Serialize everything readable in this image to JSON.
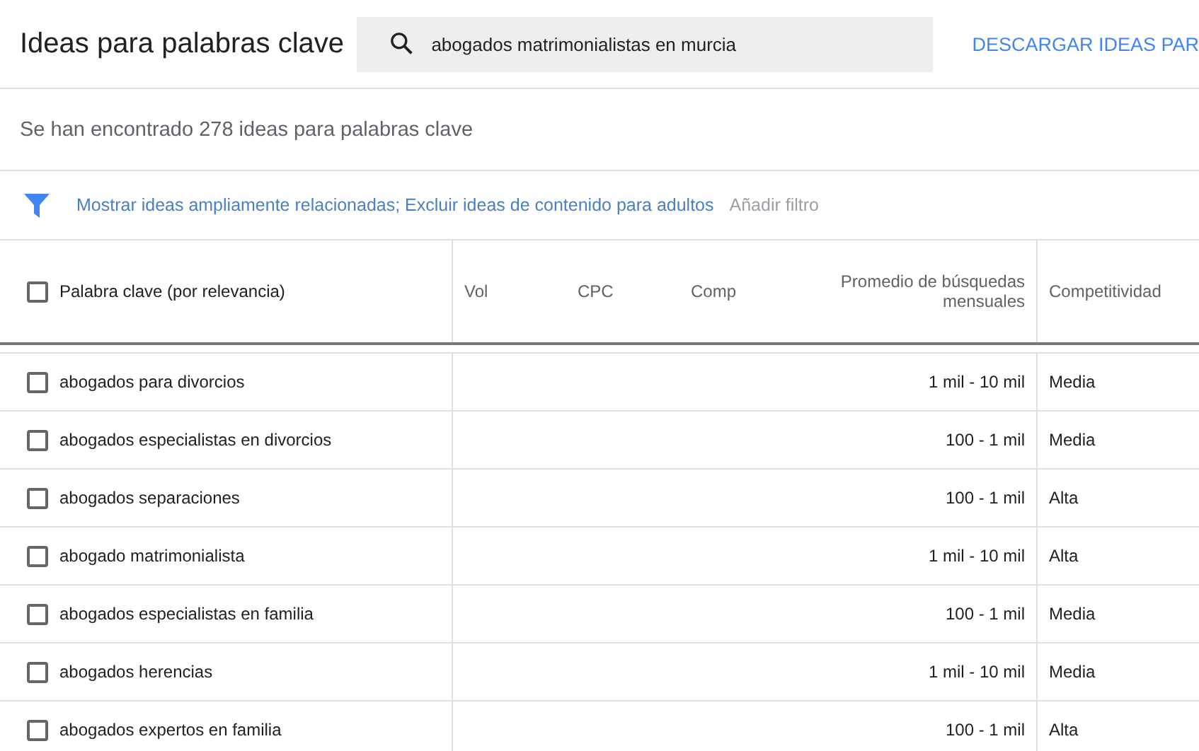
{
  "header": {
    "title": "Ideas para palabras clave",
    "search": {
      "value": "abogados matrimonialistas en murcia"
    },
    "download_button": "DESCARGAR IDEAS PAR"
  },
  "summary": "Se han encontrado 278 ideas para palabras clave",
  "filter": {
    "text": "Mostrar ideas ampliamente relacionadas; Excluir ideas de contenido para adultos",
    "add_filter": "Añadir filtro"
  },
  "table": {
    "select_all": {
      "checked": false
    },
    "columns": [
      "Palabra clave (por relevancia)",
      "Vol",
      "CPC",
      "Comp",
      "Promedio de búsquedas mensuales",
      "Competitividad"
    ],
    "rows": [
      {
        "keyword": "abogados para divorcios",
        "searches": "1 mil - 10 mil",
        "competition": "Media",
        "checked": false
      },
      {
        "keyword": "abogados especialistas en divorcios",
        "searches": "100 - 1 mil",
        "competition": "Media",
        "checked": false
      },
      {
        "keyword": "abogados separaciones",
        "searches": "100 - 1 mil",
        "competition": "Alta",
        "checked": false
      },
      {
        "keyword": "abogado matrimonialista",
        "searches": "1 mil - 10 mil",
        "competition": "Alta",
        "checked": false
      },
      {
        "keyword": "abogados especialistas en familia",
        "searches": "100 - 1 mil",
        "competition": "Media",
        "checked": false
      },
      {
        "keyword": "abogados herencias",
        "searches": "1 mil - 10 mil",
        "competition": "Media",
        "checked": false
      },
      {
        "keyword": "abogados expertos en familia",
        "searches": "100 - 1 mil",
        "competition": "Alta",
        "checked": false
      }
    ]
  }
}
